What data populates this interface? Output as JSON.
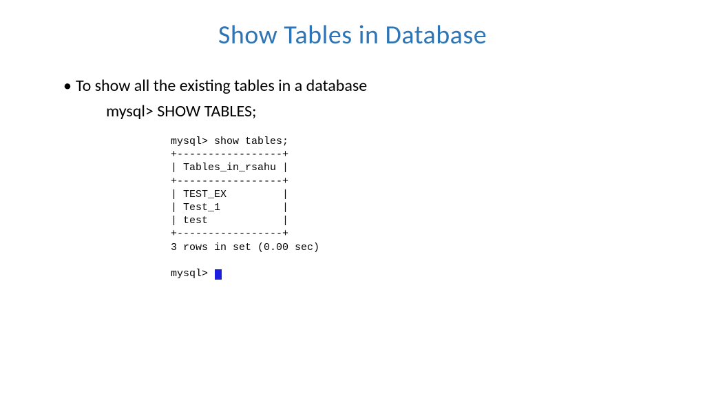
{
  "title": "Show Tables in Database",
  "bullets": {
    "main": "To show all the existing tables in a database",
    "sub": "mysql> SHOW TABLES;"
  },
  "terminal": {
    "line1": "mysql> show tables;",
    "line2": "+-----------------+",
    "line3": "| Tables_in_rsahu |",
    "line4": "+-----------------+",
    "line5": "| TEST_EX         |",
    "line6": "| Test_1          |",
    "line7": "| test            |",
    "line8": "+-----------------+",
    "line9": "3 rows in set (0.00 sec)",
    "blank": "",
    "prompt": "mysql> "
  }
}
